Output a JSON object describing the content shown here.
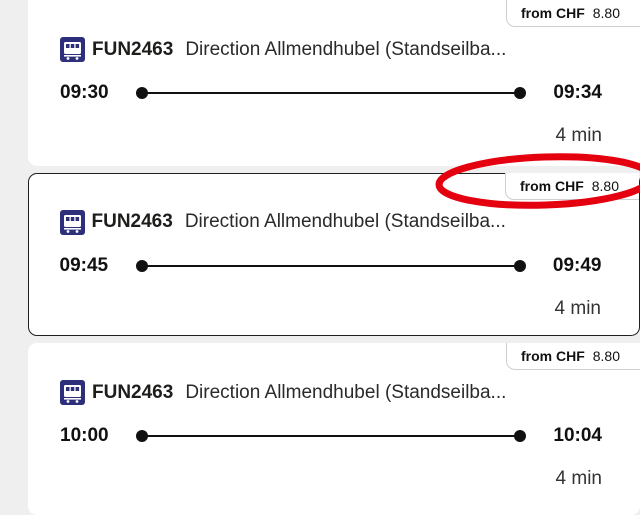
{
  "connections": [
    {
      "price_label": "from CHF",
      "price_amount": "8.80",
      "train_number": "FUN2463",
      "direction": "Direction Allmendhubel (Standseilba...",
      "departure": "09:30",
      "arrival": "09:34",
      "duration": "4 min",
      "selected": false
    },
    {
      "price_label": "from CHF",
      "price_amount": "8.80",
      "train_number": "FUN2463",
      "direction": "Direction Allmendhubel (Standseilba...",
      "departure": "09:45",
      "arrival": "09:49",
      "duration": "4 min",
      "selected": true
    },
    {
      "price_label": "from CHF",
      "price_amount": "8.80",
      "train_number": "FUN2463",
      "direction": "Direction Allmendhubel (Standseilba...",
      "departure": "10:00",
      "arrival": "10:04",
      "duration": "4 min",
      "selected": false
    }
  ],
  "icons": {
    "transport": "funicular-icon"
  },
  "colors": {
    "icon_background": "#2d2f7a",
    "annotation": "#e4000f",
    "selected_border": "#1f1f1f"
  }
}
